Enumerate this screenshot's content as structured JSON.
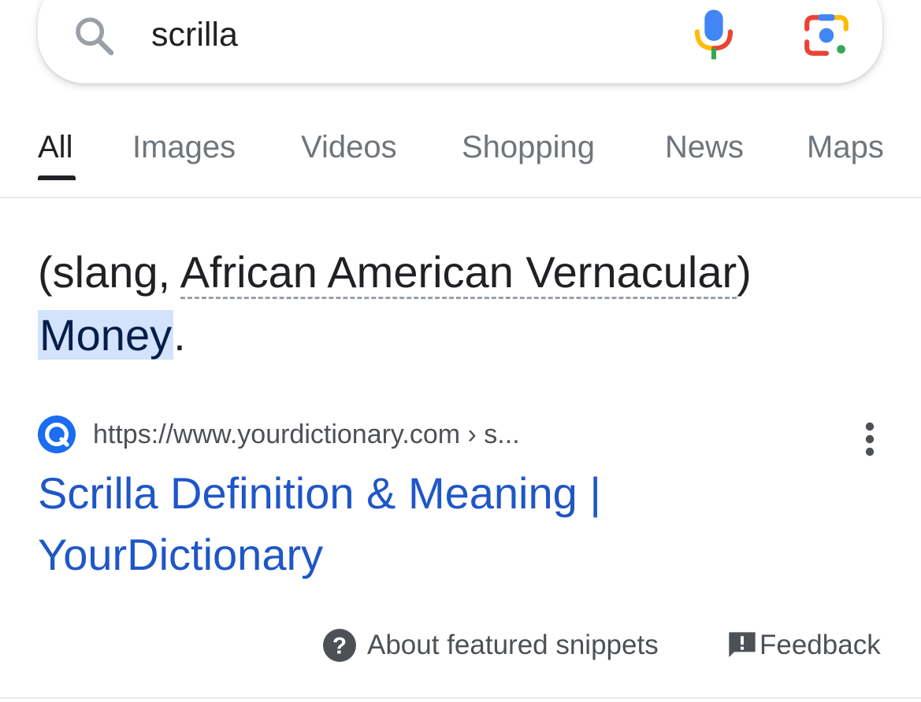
{
  "search": {
    "query": "scrilla",
    "icons": [
      "search-icon",
      "mic-icon",
      "lens-camera-icon"
    ]
  },
  "tabs": [
    {
      "label": "All",
      "active": true
    },
    {
      "label": "Images",
      "active": false
    },
    {
      "label": "Videos",
      "active": false
    },
    {
      "label": "Shopping",
      "active": false
    },
    {
      "label": "News",
      "active": false
    },
    {
      "label": "Maps",
      "active": false
    }
  ],
  "snippet": {
    "prefix": "(slang, ",
    "qualifier": "African American Vernacular",
    "suffix": ")",
    "answer": "Money",
    "period": "."
  },
  "source": {
    "url": "https://www.yourdictionary.com › s...",
    "title_line1": "Scrilla Definition & Meaning |",
    "title_line2": "YourDictionary",
    "favicon": "yourdictionary-favicon"
  },
  "footer": {
    "about_label": "About featured snippets",
    "feedback_label": "Feedback"
  },
  "colors": {
    "link": "#1f56c8",
    "highlight": "#d3e3fd",
    "muted": "#70757a",
    "text": "#202124"
  }
}
